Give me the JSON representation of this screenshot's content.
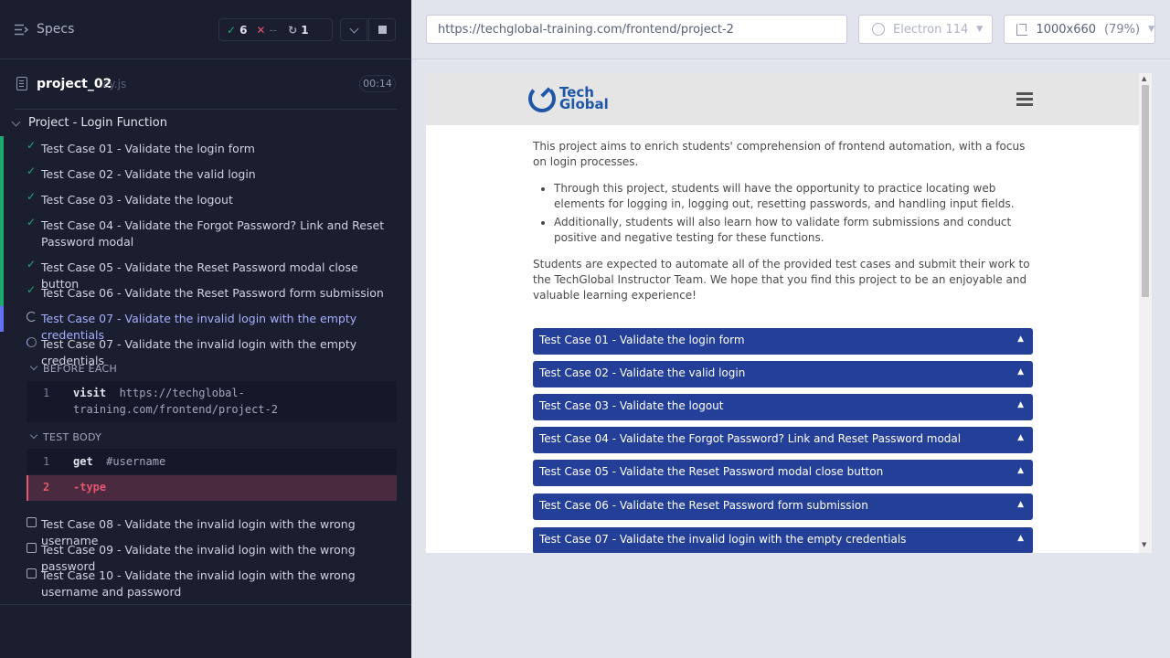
{
  "reporter": {
    "specs_label": "Specs",
    "stats": {
      "passed": "6",
      "failed": "--",
      "pending": "1"
    },
    "spec": {
      "name": "project_02",
      "ext": ".cy.js",
      "duration": "00:14"
    },
    "suite_title": "Project - Login Function",
    "tests": [
      {
        "title": "Test Case 01 - Validate the login form",
        "state": "passed"
      },
      {
        "title": "Test Case 02 - Validate the valid login",
        "state": "passed"
      },
      {
        "title": "Test Case 03 - Validate the logout",
        "state": "passed"
      },
      {
        "title": "Test Case 04 - Validate the Forgot Password? Link and Reset Password modal",
        "state": "passed"
      },
      {
        "title": "Test Case 05 - Validate the Reset Password modal close button",
        "state": "passed"
      },
      {
        "title": "Test Case 06 - Validate the Reset Password form submission",
        "state": "passed"
      },
      {
        "title": "Test Case 07 - Validate the invalid login with the empty credentials",
        "state": "running"
      },
      {
        "title": "Test Case 07 - Validate the invalid login with the empty credentials",
        "state": "active"
      },
      {
        "title": "Test Case 08 - Validate the invalid login with the wrong username",
        "state": "queued"
      },
      {
        "title": "Test Case 09 - Validate the invalid login with the wrong password",
        "state": "queued"
      },
      {
        "title": "Test Case 10 - Validate the invalid login with the wrong username and password",
        "state": "queued"
      }
    ],
    "before_each": {
      "label": "BEFORE EACH",
      "commands": [
        {
          "n": "1",
          "name": "visit",
          "arg_line1": "https://techglobal-",
          "arg_line2": "training.com/frontend/project-2"
        }
      ]
    },
    "test_body": {
      "label": "TEST BODY",
      "commands": [
        {
          "n": "1",
          "name": "get",
          "arg": "#username"
        },
        {
          "n": "2",
          "name": "-type",
          "arg": ""
        }
      ]
    }
  },
  "aut": {
    "url": "https://techglobal-training.com/frontend/project-2",
    "browser": "Electron 114",
    "viewport": "1000x660",
    "scale": "(79%)",
    "logo_line1": "Tech",
    "logo_line2": "Global",
    "intro": "This project aims to enrich students' comprehension of frontend automation, with a focus on login processes.",
    "bullets": [
      "Through this project, students will have the opportunity to practice locating web elements for logging in, logging out, resetting passwords, and handling input fields.",
      "Additionally, students will also learn how to validate form submissions and conduct positive and negative testing for these functions."
    ],
    "outro": "Students are expected to automate all of the provided test cases and submit their work to the TechGlobal Instructor Team. We hope that you find this project to be an enjoyable and valuable learning experience!",
    "accordions": [
      "Test Case 01 - Validate the login form",
      "Test Case 02 - Validate the valid login",
      "Test Case 03 - Validate the logout",
      "Test Case 04 - Validate the Forgot Password? Link and Reset Password modal",
      "Test Case 05 - Validate the Reset Password modal close button",
      "Test Case 06 - Validate the Reset Password form submission",
      "Test Case 07 - Validate the invalid login with the empty credentials"
    ]
  },
  "colors": {
    "passed": "#1fa971",
    "failed": "#e45770",
    "running": "#6470f3",
    "accordion": "#243f97",
    "brand": "#1f57a6"
  }
}
